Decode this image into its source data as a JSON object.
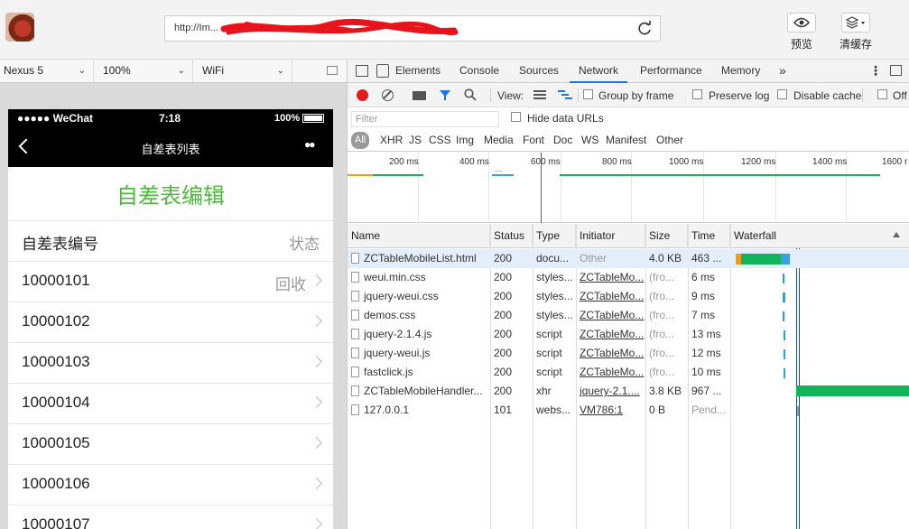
{
  "browser": {
    "url": "http://Im...",
    "preview_label": "预览",
    "clear_cache_label": "清缓存"
  },
  "device_bar": {
    "device": "Nexus 5",
    "zoom": "100%",
    "network": "WiFi"
  },
  "phone": {
    "carrier": "●●●●● WeChat",
    "time": "7:18",
    "battery": "100%",
    "nav_title": "自差表列表",
    "nav_more": "●●",
    "page_title": "自差表编辑",
    "header_id": "自差表编号",
    "header_status": "状态",
    "rows": [
      {
        "id": "10000101",
        "status": "回收"
      },
      {
        "id": "10000102",
        "status": ""
      },
      {
        "id": "10000103",
        "status": ""
      },
      {
        "id": "10000104",
        "status": ""
      },
      {
        "id": "10000105",
        "status": ""
      },
      {
        "id": "10000106",
        "status": ""
      },
      {
        "id": "10000107",
        "status": ""
      }
    ]
  },
  "devtools": {
    "tabs": [
      "Elements",
      "Console",
      "Sources",
      "Network",
      "Performance",
      "Memory"
    ],
    "active_tab": "Network",
    "more_tabs": "»",
    "toolbar": {
      "view_label": "View:",
      "group_by_frame": "Group by frame",
      "preserve_log": "Preserve log",
      "disable_cache": "Disable cache",
      "offline": "Off"
    },
    "filter_placeholder": "Filter",
    "hide_data_urls": "Hide data URLs",
    "types": [
      "All",
      "XHR",
      "JS",
      "CSS",
      "Img",
      "Media",
      "Font",
      "Doc",
      "WS",
      "Manifest",
      "Other"
    ],
    "timeline_ticks": [
      "200 ms",
      "400 ms",
      "600 ms",
      "800 ms",
      "1000 ms",
      "1200 ms",
      "1400 ms",
      "1600 r"
    ],
    "columns": [
      "Name",
      "Status",
      "Type",
      "Initiator",
      "Size",
      "Time",
      "Waterfall"
    ],
    "requests": [
      {
        "name": "ZCTableMobileList.html",
        "status": "200",
        "type": "docu...",
        "initiator": "Other",
        "size": "4.0 KB",
        "time": "463 ..."
      },
      {
        "name": "weui.min.css",
        "status": "200",
        "type": "styles...",
        "initiator": "ZCTableMo...",
        "size": "(fro...",
        "time": "6 ms"
      },
      {
        "name": "jquery-weui.css",
        "status": "200",
        "type": "styles...",
        "initiator": "ZCTableMo...",
        "size": "(fro...",
        "time": "9 ms"
      },
      {
        "name": "demos.css",
        "status": "200",
        "type": "styles...",
        "initiator": "ZCTableMo...",
        "size": "(fro...",
        "time": "7 ms"
      },
      {
        "name": "jquery-2.1.4.js",
        "status": "200",
        "type": "script",
        "initiator": "ZCTableMo...",
        "size": "(fro...",
        "time": "13 ms"
      },
      {
        "name": "jquery-weui.js",
        "status": "200",
        "type": "script",
        "initiator": "ZCTableMo...",
        "size": "(fro...",
        "time": "12 ms"
      },
      {
        "name": "fastclick.js",
        "status": "200",
        "type": "script",
        "initiator": "ZCTableMo...",
        "size": "(fro...",
        "time": "10 ms"
      },
      {
        "name": "ZCTableMobileHandler...",
        "status": "200",
        "type": "xhr",
        "initiator": "jquery-2.1....",
        "size": "3.8 KB",
        "time": "967 ..."
      },
      {
        "name": "127.0.0.1",
        "status": "101",
        "type": "webs...",
        "initiator": "VM786:1",
        "size": "0 B",
        "time": "Pend..."
      }
    ]
  }
}
